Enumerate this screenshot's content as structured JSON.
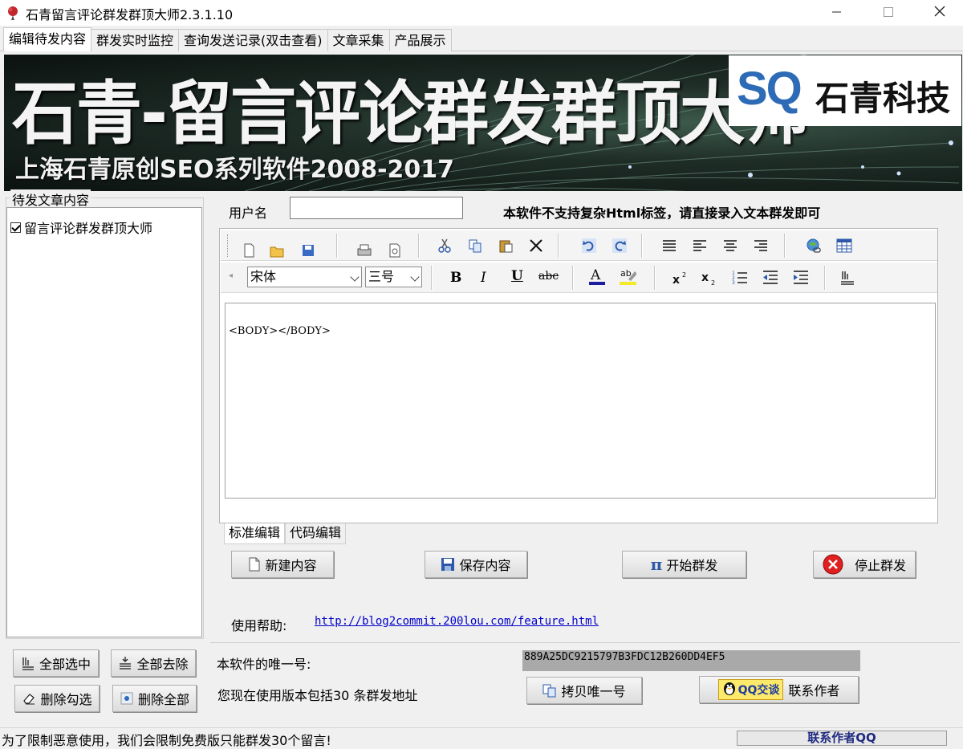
{
  "window": {
    "title": "石青留言评论群发群顶大师2.3.1.10",
    "icons": {
      "app": "red-flower-icon",
      "minimize": "minimize-icon",
      "maximize": "maximize-icon",
      "close": "close-icon"
    }
  },
  "tabs": [
    {
      "label": "编辑待发内容",
      "active": true
    },
    {
      "label": "群发实时监控"
    },
    {
      "label": "查询发送记录(双击查看)"
    },
    {
      "label": "文章采集"
    },
    {
      "label": "产品展示"
    }
  ],
  "banner": {
    "title": "石青-留言评论群发群顶大师",
    "subtitle": "上海石青原创SEO系列软件2008-2017",
    "logo_mark": "SQ",
    "logo_text": "石青科技"
  },
  "left_panel": {
    "group_label": "待发文章内容",
    "items": [
      {
        "label": "留言评论群发群顶大师",
        "checked": true
      }
    ],
    "buttons": {
      "select_all": "全部选中",
      "deselect_all": "全部去除",
      "delete_checked": "删除勾选",
      "delete_all": "删除全部"
    }
  },
  "form": {
    "username_label": "用户名",
    "username_value": "",
    "notice": "本软件不支持复杂Html标签，请直接录入文本群发即可"
  },
  "editor": {
    "font_family": "宋体",
    "font_size": "三号",
    "formatting": {
      "bold": "B",
      "italic": "I",
      "underline": "U",
      "strike": "abc"
    },
    "content": "<BODY></BODY>",
    "mode_tabs": [
      {
        "label": "标准编辑",
        "active": true
      },
      {
        "label": "代码编辑"
      }
    ]
  },
  "actions": {
    "new": "新建内容",
    "save": "保存内容",
    "start": "开始群发",
    "stop": "停止群发"
  },
  "help": {
    "label": "使用帮助:",
    "link": "http://blog2commit.200lou.com/feature.html"
  },
  "license": {
    "uid_label": "本软件的唯一号:",
    "uid_value": "889A25DC9215797B3FDC12B260DD4EF5",
    "version_info": "您现在使用版本包括30 条群发地址",
    "copy_button": "拷贝唯一号",
    "qq_badge": "QQ交谈",
    "contact": "联系作者"
  },
  "status": {
    "message": "为了限制恶意使用，我们会限制免费版只能群发30个留言!",
    "panel": "联系作者QQ"
  },
  "colors": {
    "accent_blue": "#2d6bb6",
    "link": "#0000cc",
    "stop_red": "#e02020"
  }
}
